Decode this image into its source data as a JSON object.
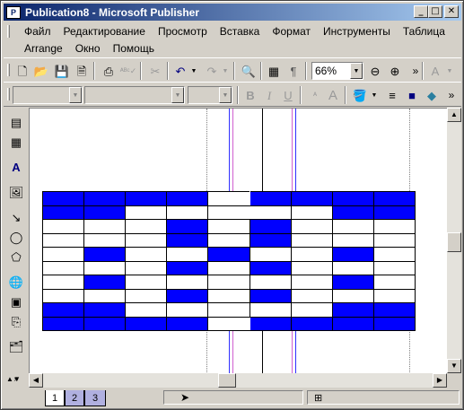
{
  "window": {
    "title": "Publication8 - Microsoft Publisher",
    "app_icon_letter": "P",
    "minimize": "_",
    "maximize": "□",
    "close": "✕"
  },
  "menu": {
    "row1": [
      "Файл",
      "Редактирование",
      "Просмотр",
      "Вставка",
      "Формат",
      "Инструменты",
      "Таблица"
    ],
    "row2": [
      "Arrange",
      "Окно",
      "Помощь"
    ]
  },
  "toolbar": {
    "zoom_value": "66%",
    "font_name": "",
    "font_style": "",
    "font_size": "",
    "bold_label": "B",
    "italic_label": "I",
    "underline_label": "U",
    "overflow": "»"
  },
  "table": {
    "rows": [
      [
        "b",
        "b",
        "b",
        "b",
        "m",
        "b",
        "b",
        "b",
        "b"
      ],
      [
        "b",
        "b",
        "w",
        "w",
        "m",
        "w",
        "w",
        "b",
        "b"
      ],
      [
        "w",
        "w",
        "w",
        "b",
        "w",
        "b",
        "w",
        "w",
        "w"
      ],
      [
        "w",
        "w",
        "w",
        "b",
        "w",
        "b",
        "w",
        "w",
        "w"
      ],
      [
        "w",
        "b",
        "w",
        "w",
        "b",
        "w",
        "w",
        "b",
        "w"
      ],
      [
        "w",
        "w",
        "w",
        "b",
        "w",
        "b",
        "w",
        "w",
        "w"
      ],
      [
        "w",
        "b",
        "w",
        "w",
        "w",
        "w",
        "w",
        "b",
        "w"
      ],
      [
        "w",
        "w",
        "w",
        "b",
        "w",
        "b",
        "w",
        "w",
        "w"
      ],
      [
        "b",
        "b",
        "w",
        "w",
        "w",
        "w",
        "w",
        "b",
        "b"
      ],
      [
        "b",
        "b",
        "b",
        "b",
        "m",
        "b",
        "b",
        "b",
        "b"
      ]
    ],
    "fill_color": "#0000ff"
  },
  "status": {
    "pages": [
      "1",
      "2",
      "3"
    ],
    "current_page": "1"
  }
}
